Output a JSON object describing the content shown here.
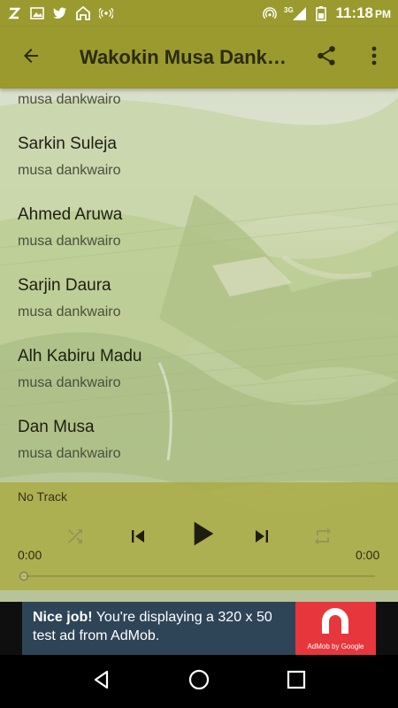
{
  "status_bar": {
    "time": "11:18",
    "ampm": "PM",
    "network_label": "3G",
    "icons": [
      "z-app-icon",
      "image-icon",
      "twitter-icon",
      "home-icon",
      "broadcast-icon",
      "wifi-hotspot-icon",
      "signal-icon",
      "battery-icon"
    ]
  },
  "app_bar": {
    "title": "Wakokin Musa Dankwairo",
    "back_icon": "arrow-left-icon",
    "share_icon": "share-icon",
    "more_icon": "more-vertical-icon"
  },
  "tracks": [
    {
      "title": "",
      "artist": "musa dankwairo"
    },
    {
      "title": "Sarkin Suleja",
      "artist": "musa dankwairo"
    },
    {
      "title": "Ahmed Aruwa",
      "artist": "musa dankwairo"
    },
    {
      "title": "Sarjin Daura",
      "artist": "musa dankwairo"
    },
    {
      "title": "Alh Kabiru Madu",
      "artist": "musa dankwairo"
    },
    {
      "title": "Dan Musa",
      "artist": "musa dankwairo"
    }
  ],
  "player": {
    "now_playing": "No Track",
    "elapsed": "0:00",
    "duration": "0:00",
    "progress": 0,
    "controls": [
      "shuffle-icon",
      "skip-previous-icon",
      "play-icon",
      "skip-next-icon",
      "repeat-icon"
    ]
  },
  "ad": {
    "headline": "Nice job!",
    "body": "You're displaying a 320 x 50 test ad from AdMob.",
    "logo_label": "AdMob by Google",
    "colors": {
      "background": "#2e4557",
      "logo": "#e8373c"
    }
  },
  "nav_bar": {
    "buttons": [
      "back-triangle-icon",
      "home-circle-icon",
      "recents-square-icon"
    ]
  },
  "colors": {
    "accent": "#9a9a2e",
    "player_bg": "#a8a634"
  }
}
